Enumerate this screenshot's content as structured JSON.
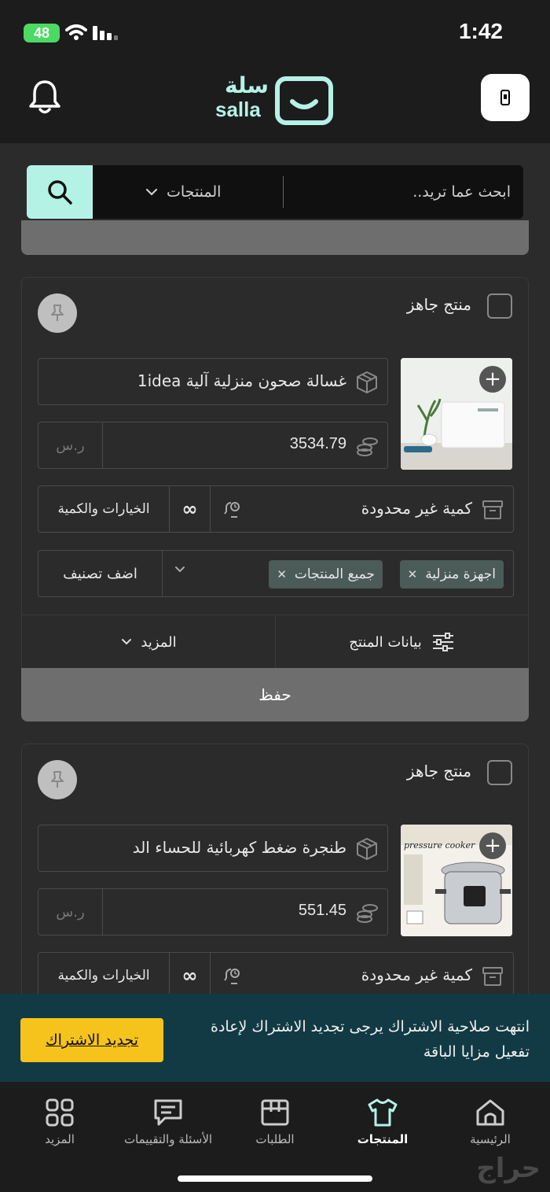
{
  "status_bar": {
    "battery": "48",
    "time": "1:42"
  },
  "header": {
    "logo_ar": "سلة",
    "logo_en": "salla"
  },
  "search": {
    "placeholder": "ابحث عما تريد..",
    "scope": "المنتجات"
  },
  "products": [
    {
      "ready_label": "منتج جاهز",
      "name": "غسالة صحون منزلية آلية 1idea",
      "price": "3534.79",
      "currency": "ر.س",
      "quantity": "كمية غير محدودة",
      "options_label": "الخيارات والكمية",
      "infinity": "∞",
      "categories": [
        "اجهزة منزلية",
        "جميع المنتجات"
      ],
      "add_category": "اضف تصنيف",
      "product_data": "بيانات المنتج",
      "more": "المزيد",
      "save": "حفظ"
    },
    {
      "ready_label": "منتج جاهز",
      "name": "طنجرة ضغط كهربائية للحساء الد",
      "price": "551.45",
      "currency": "ر.س",
      "quantity": "كمية غير محدودة",
      "options_label": "الخيارات والكمية",
      "infinity": "∞",
      "image_text": "pressure cooker"
    }
  ],
  "banner": {
    "message": "انتهت صلاحية الاشتراك يرجى تجديد الاشتراك لإعادة تفعيل مزايا الباقة",
    "button": "تجديد الاشتراك"
  },
  "bottom_nav": {
    "home": "الرئيسية",
    "products": "المنتجات",
    "orders": "الطلبات",
    "qa": "الأسئلة والتقييمات",
    "more": "المزيد"
  },
  "watermark": "حراج",
  "colors": {
    "accent": "#b5f2e6",
    "banner_bg": "#113a45",
    "renew_button": "#f5c31c"
  }
}
